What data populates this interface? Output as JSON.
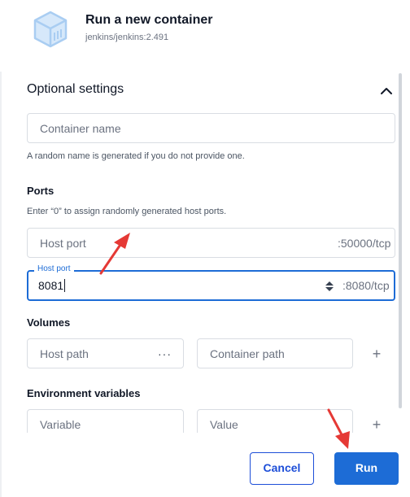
{
  "header": {
    "title": "Run a new container",
    "image": "jenkins/jenkins:2.491",
    "icon": "container-cube-icon"
  },
  "optional_settings": {
    "title": "Optional settings",
    "toggle_icon": "chevron-up-icon",
    "container_name": {
      "placeholder": "Container name",
      "value": "",
      "help": "A random name is generated if you do not provide one."
    },
    "ports": {
      "title": "Ports",
      "help": "Enter “0” to assign randomly generated host ports.",
      "mappings": [
        {
          "label": "Host port",
          "placeholder": "Host port",
          "value": "",
          "container_port": ":50000/tcp"
        },
        {
          "label": "Host port",
          "placeholder": "Host port",
          "value": "8081",
          "container_port": ":8080/tcp"
        }
      ]
    },
    "volumes": {
      "title": "Volumes",
      "host_path_placeholder": "Host path",
      "browse_label": "···",
      "container_path_placeholder": "Container path",
      "add_label": "+"
    },
    "env": {
      "title": "Environment variables",
      "variable_placeholder": "Variable",
      "value_placeholder": "Value",
      "add_label": "+"
    }
  },
  "footer": {
    "cancel_label": "Cancel",
    "run_label": "Run"
  },
  "colors": {
    "accent": "#1d6cd6",
    "annotation_arrow": "#e53935",
    "icon_tint": "#b3d4f5"
  }
}
